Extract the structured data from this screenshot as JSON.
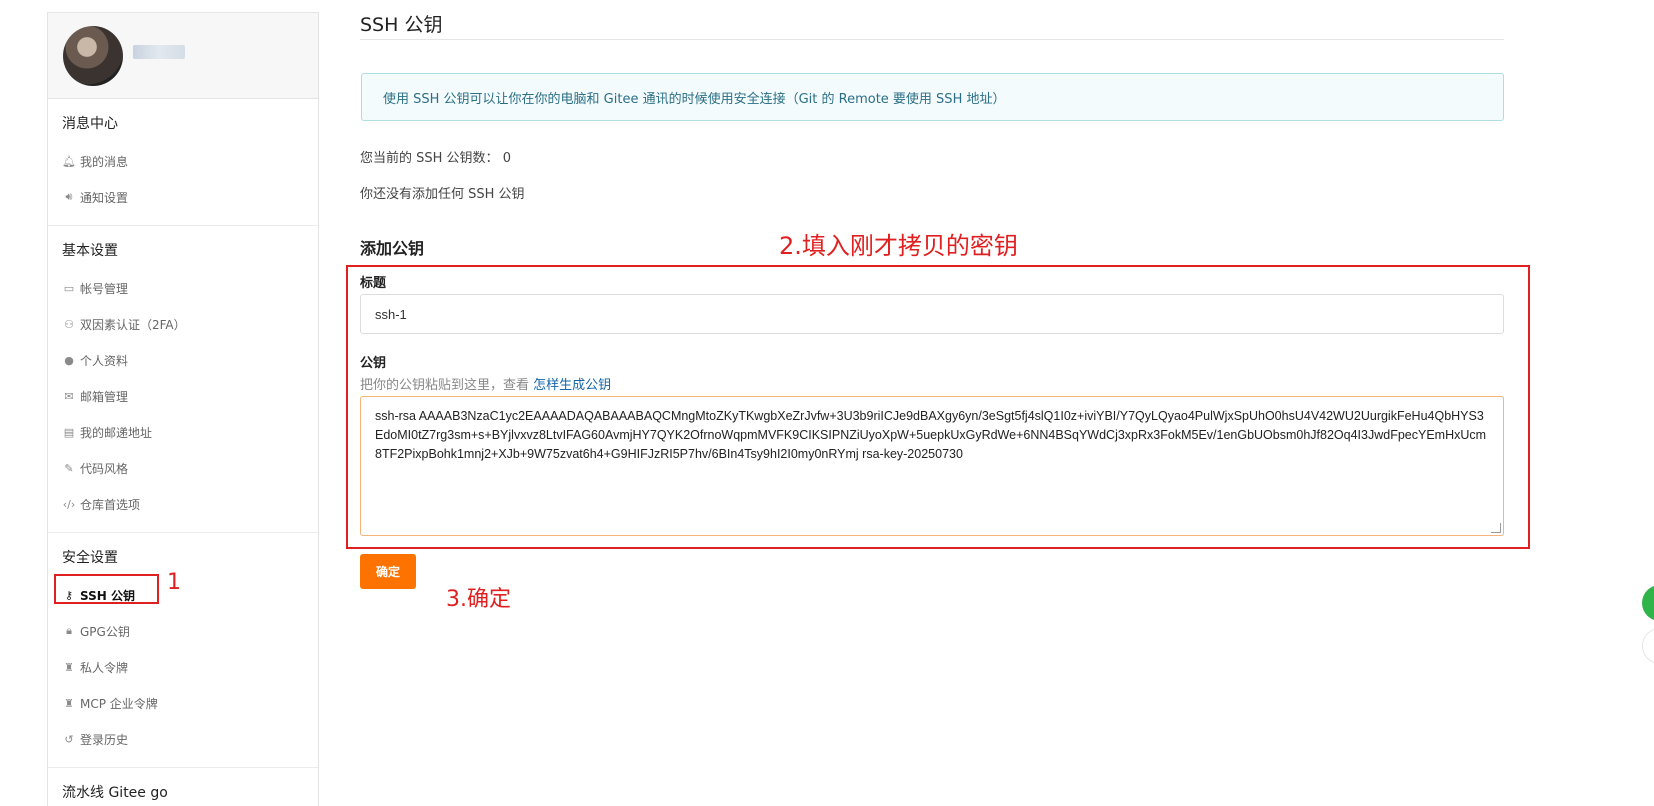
{
  "sidebar": {
    "sections": [
      {
        "title": "消息中心",
        "items": [
          {
            "label": "我的消息",
            "icon": "bell-icon"
          },
          {
            "label": "通知设置",
            "icon": "speaker-icon"
          }
        ]
      },
      {
        "title": "基本设置",
        "items": [
          {
            "label": "帐号管理",
            "icon": "id-card-icon"
          },
          {
            "label": "双因素认证（2FA）",
            "icon": "user-shield-icon"
          },
          {
            "label": "个人资料",
            "icon": "user-icon"
          },
          {
            "label": "邮箱管理",
            "icon": "envelope-icon"
          },
          {
            "label": "我的邮递地址",
            "icon": "address-card-icon"
          },
          {
            "label": "代码风格",
            "icon": "brush-icon"
          },
          {
            "label": "仓库首选项",
            "icon": "code-icon"
          }
        ]
      },
      {
        "title": "安全设置",
        "items": [
          {
            "label": "SSH 公钥",
            "icon": "key-icon"
          },
          {
            "label": "GPG公钥",
            "icon": "lock-icon"
          },
          {
            "label": "私人令牌",
            "icon": "token-icon"
          },
          {
            "label": "MCP 企业令牌",
            "icon": "token-icon"
          },
          {
            "label": "登录历史",
            "icon": "history-icon"
          }
        ]
      },
      {
        "title": "流水线 Gitee go",
        "items": []
      }
    ]
  },
  "main": {
    "title": "SSH 公钥",
    "info": "使用 SSH 公钥可以让你在你的电脑和 Gitee 通讯的时候使用安全连接（Git 的 Remote 要使用 SSH 地址）",
    "count_label": "您当前的 SSH 公钥数：",
    "count_value": "0",
    "empty_text": "你还没有添加任何 SSH 公钥",
    "add_title": "添加公钥",
    "title_label": "标题",
    "title_value": "ssh-1",
    "key_label": "公钥",
    "help_text": "把你的公钥粘贴到这里，查看 ",
    "help_link": "怎样生成公钥",
    "key_value": "ssh-rsa AAAAB3NzaC1yc2EAAAADAQABAAABAQCMngMtoZKyTKwgbXeZrJvfw+3U3b9riICJe9dBAXgy6yn/3eSgt5fj4slQ1I0z+iviYBI/Y7QyLQyao4PulWjxSpUhO0hsU4V42WU2UurgikFeHu4QbHYS3EdoMI0tZ7rg3sm+s+BYjlvxvz8LtvIFAG60AvmjHY7QYK2OfrnoWqpmMVFK9CIKSIPNZiUyoXpW+5uepkUxGyRdWe+6NN4BSqYWdCj3xpRx3FokM5Ev/1enGbUObsm0hJf82Oq4I3JwdFpecYEmHxUcm8TF2PixpBohk1mnj2+XJb+9W75zvat6h4+G9HIFJzRI5P7hv/6BIn4Tsy9hI2I0my0nRYmj rsa-key-20250730",
    "confirm_label": "确定"
  },
  "annotations": {
    "step1": "1",
    "step2": "2.填入刚才拷贝的密钥",
    "step3": "3.确定"
  },
  "colors": {
    "accent": "#fe7300",
    "annotation": "#e02020",
    "info_text": "#2b6f86",
    "link": "#1566a8"
  }
}
